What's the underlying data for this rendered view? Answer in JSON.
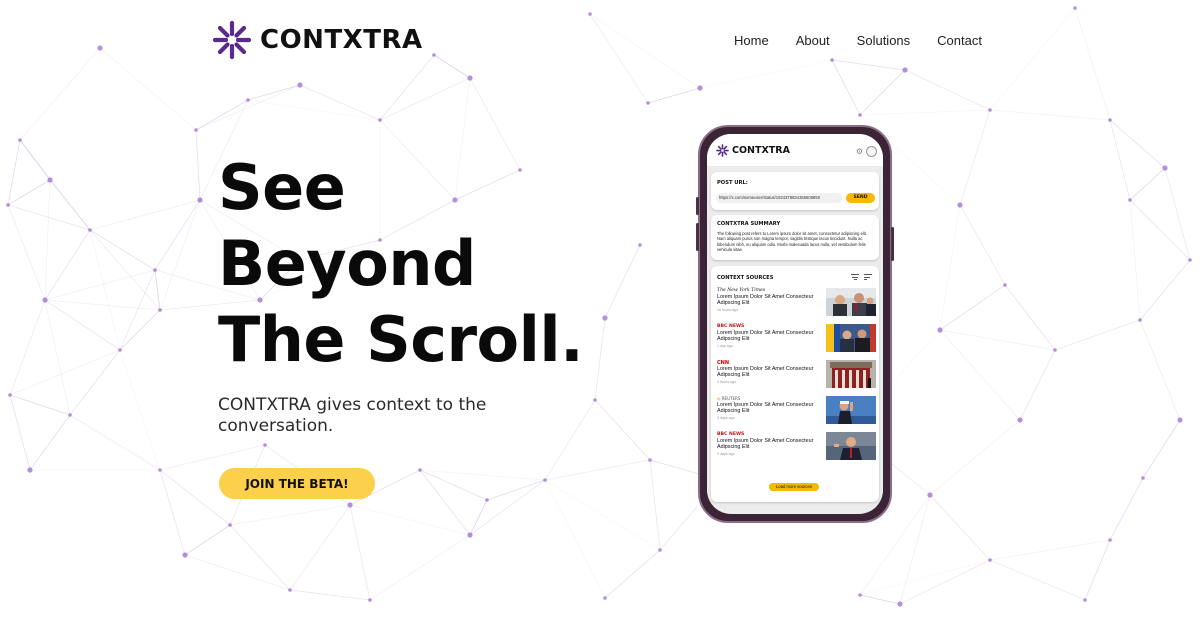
{
  "brand": {
    "name": "CONTXTRA",
    "accent": "#5a2a8c",
    "network_color": "#9b6fd0"
  },
  "nav": {
    "items": [
      "Home",
      "About",
      "Solutions",
      "Contact"
    ]
  },
  "hero": {
    "title_lines": [
      "See",
      "Beyond",
      "The Scroll."
    ],
    "subtitle": "CONTXTRA gives context to the conversation.",
    "cta_label": "JOIN THE BETA!",
    "cta_color": "#fcd04a"
  },
  "phone": {
    "app_name": "CONTXTRA",
    "post_url": {
      "label": "POST URL:",
      "value": "https://x.com/someuser/status/1924378834355609850",
      "send_label": "SEND"
    },
    "summary": {
      "label": "CONTXTRA SUMMARY",
      "text": "The following post refers to Lorem ipsum dolor sit amet, consectetur adipiscing elit. Nam aliquam purus non magna tempor, sagittis tristique lacus tincidunt. Nulla ac bibendum nibh, eu aliquam odio. Morbi malesuada lacus nulla, vel vestibulum felis vehicula vitae."
    },
    "sources": {
      "label": "CONTEXT SOURCES",
      "items": [
        {
          "brand": "The New York Times",
          "title": "Lorem Ipsum Dolor Sit Amet Consecteur Adipscing Elit",
          "time": "16 hours ago"
        },
        {
          "brand": "BBC NEWS",
          "title": "Lorem Ipsum Dolor Sit Amet Consecteur Adipscing Elit",
          "time": "1 day ago"
        },
        {
          "brand": "CNN",
          "title": "Lorem Ipsum Dolor Sit Amet Consecteur Adipscing Elit",
          "time": "4 hours ago"
        },
        {
          "brand": "REUTERS",
          "title": "Lorem Ipsum Dolor Sit Amet Consecteur Adipscing Elit",
          "time": "3 days ago"
        },
        {
          "brand": "BBC NEWS",
          "title": "Lorem Ipsum Dolor Sit Amet Consecteur Adipscing Elit",
          "time": "2 days ago"
        }
      ],
      "load_more_label": "Load more sources"
    }
  }
}
